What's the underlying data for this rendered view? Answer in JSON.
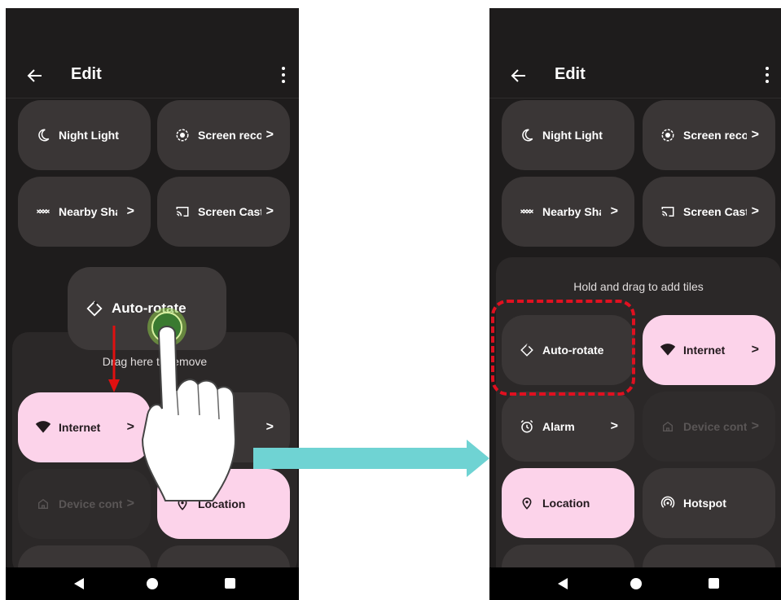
{
  "left": {
    "title": "Edit",
    "tiles": {
      "night_light": "Night Light",
      "screen_record": "Screen reco",
      "nearby_share": "Nearby Share",
      "screen_cast": "Screen Cast",
      "internet": "Internet",
      "device_controls": "Device controls",
      "location": "Location"
    },
    "dragging_tile": "Auto-rotate",
    "hint": "Drag here to remove"
  },
  "right": {
    "title": "Edit",
    "tiles": {
      "night_light": "Night Light",
      "screen_record": "Screen reco",
      "nearby_share": "Nearby Share",
      "screen_cast": "Screen Cast",
      "auto_rotate": "Auto-rotate",
      "internet": "Internet",
      "alarm": "Alarm",
      "device_controls": "Device controls",
      "location": "Location",
      "hotspot": "Hotspot"
    },
    "hint": "Hold and drag to add tiles"
  },
  "colors": {
    "background": "#1e1c1c",
    "tile": "#3a3636",
    "tile_active": "#fcd3ea",
    "highlight": "#e01020",
    "arrow_teal": "#6fd3d3"
  },
  "icons": [
    "back-arrow-icon",
    "more-vert-icon",
    "moon-icon",
    "record-icon",
    "nearby-icon",
    "cast-icon",
    "wifi-icon",
    "home-icon",
    "location-pin-icon",
    "rotate-icon",
    "alarm-icon",
    "hotspot-icon",
    "chevron-right-icon"
  ]
}
